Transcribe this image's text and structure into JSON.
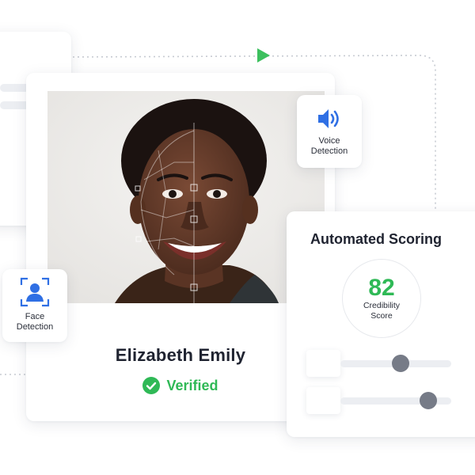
{
  "profile": {
    "name": "Elizabeth Emily",
    "status": "Verified"
  },
  "voice_detection": {
    "label_line1": "Voice",
    "label_line2": "Detection",
    "icon": "speaker-icon"
  },
  "face_detection": {
    "label_line1": "Face",
    "label_line2": "Detection",
    "icon": "person-scan-icon"
  },
  "scoring": {
    "title": "Automated Scoring",
    "score": "82",
    "score_label_line1": "Credibility",
    "score_label_line2": "Score",
    "sliders": [
      {
        "level": 0.62
      },
      {
        "level": 0.9
      }
    ]
  },
  "colors": {
    "accent_green": "#2fb956",
    "icon_blue": "#2f6fe4",
    "knob_gray": "#767b87"
  }
}
